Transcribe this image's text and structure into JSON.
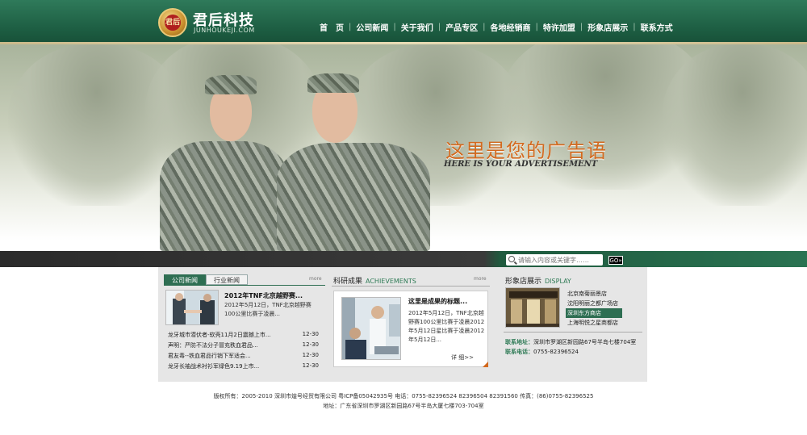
{
  "header": {
    "logo_text": "君后",
    "brand_name": "君后科技",
    "brand_domain": "JUNHOUKEJI.COM",
    "nav": [
      "首　页",
      "公司新闻",
      "关于我们",
      "产品专区",
      "各地经销商",
      "特许加盟",
      "形象店展示",
      "联系方式"
    ]
  },
  "banner": {
    "ad_title": "这里是您的广告语",
    "ad_subtitle": "HERE IS YOUR ADVERTISEMENT"
  },
  "search": {
    "placeholder": "请输入内容或关键字……",
    "go_label": "GO»"
  },
  "news_panel": {
    "tabs": [
      "公司新闻",
      "行业新闻"
    ],
    "more": "more",
    "featured_title": "2012年TNF北京越野赛...",
    "featured_desc": "2012年5月12日，TNF北京越野赛100公里比赛于凌晨...",
    "items": [
      {
        "title": "龙牙城市潜伏者-软壳11月2日震撼上市...",
        "date": "12-30"
      },
      {
        "title": "声明：严防不法分子冒充秩血君品...",
        "date": "12-30"
      },
      {
        "title": "君友毒--铁血君品行销下军适会...",
        "date": "12-30"
      },
      {
        "title": "龙牙长袖战术衬衫军绿色9.19上市...",
        "date": "12-30"
      }
    ]
  },
  "achievements_panel": {
    "title_cn": "科研成果",
    "title_en": "ACHIEVEMENTS",
    "more": "more",
    "card_title": "这里是成果的标题...",
    "card_desc": "2012年5月12日，TNF北京越野赛100公里比赛于凌晨2012年5月12日星比赛于凌晨2012年5月12日...",
    "detail_label": "详 细>>"
  },
  "display_panel": {
    "title_cn": "形象店展示",
    "title_en": "DISPLAY",
    "stores": [
      "北京南菊丽景店",
      "沈阳明丽之都广场店",
      "深圳东方商店",
      "上海明悦之星商都店"
    ],
    "active_store_index": 2,
    "contact_address_label": "联系地址：",
    "contact_address": "深圳市罗湖区新园路67号半岛七楼704室",
    "contact_phone_label": "联系电话：",
    "contact_phone": "0755-82396524"
  },
  "footer": {
    "line1": "版权所有：2005-2010  深圳市煌号经贸有限公司  粤ICP备05042935号   电话：0755-82396524  82396504  82391560  传真：(86)0755-82396525",
    "line2": "地址：广东省深圳市罗湖区新园路67号半岛大厦七楼703-704室"
  },
  "colors": {
    "header_green": "#1c5c41",
    "accent_green": "#2e6e52",
    "ad_orange": "#d2691e"
  }
}
